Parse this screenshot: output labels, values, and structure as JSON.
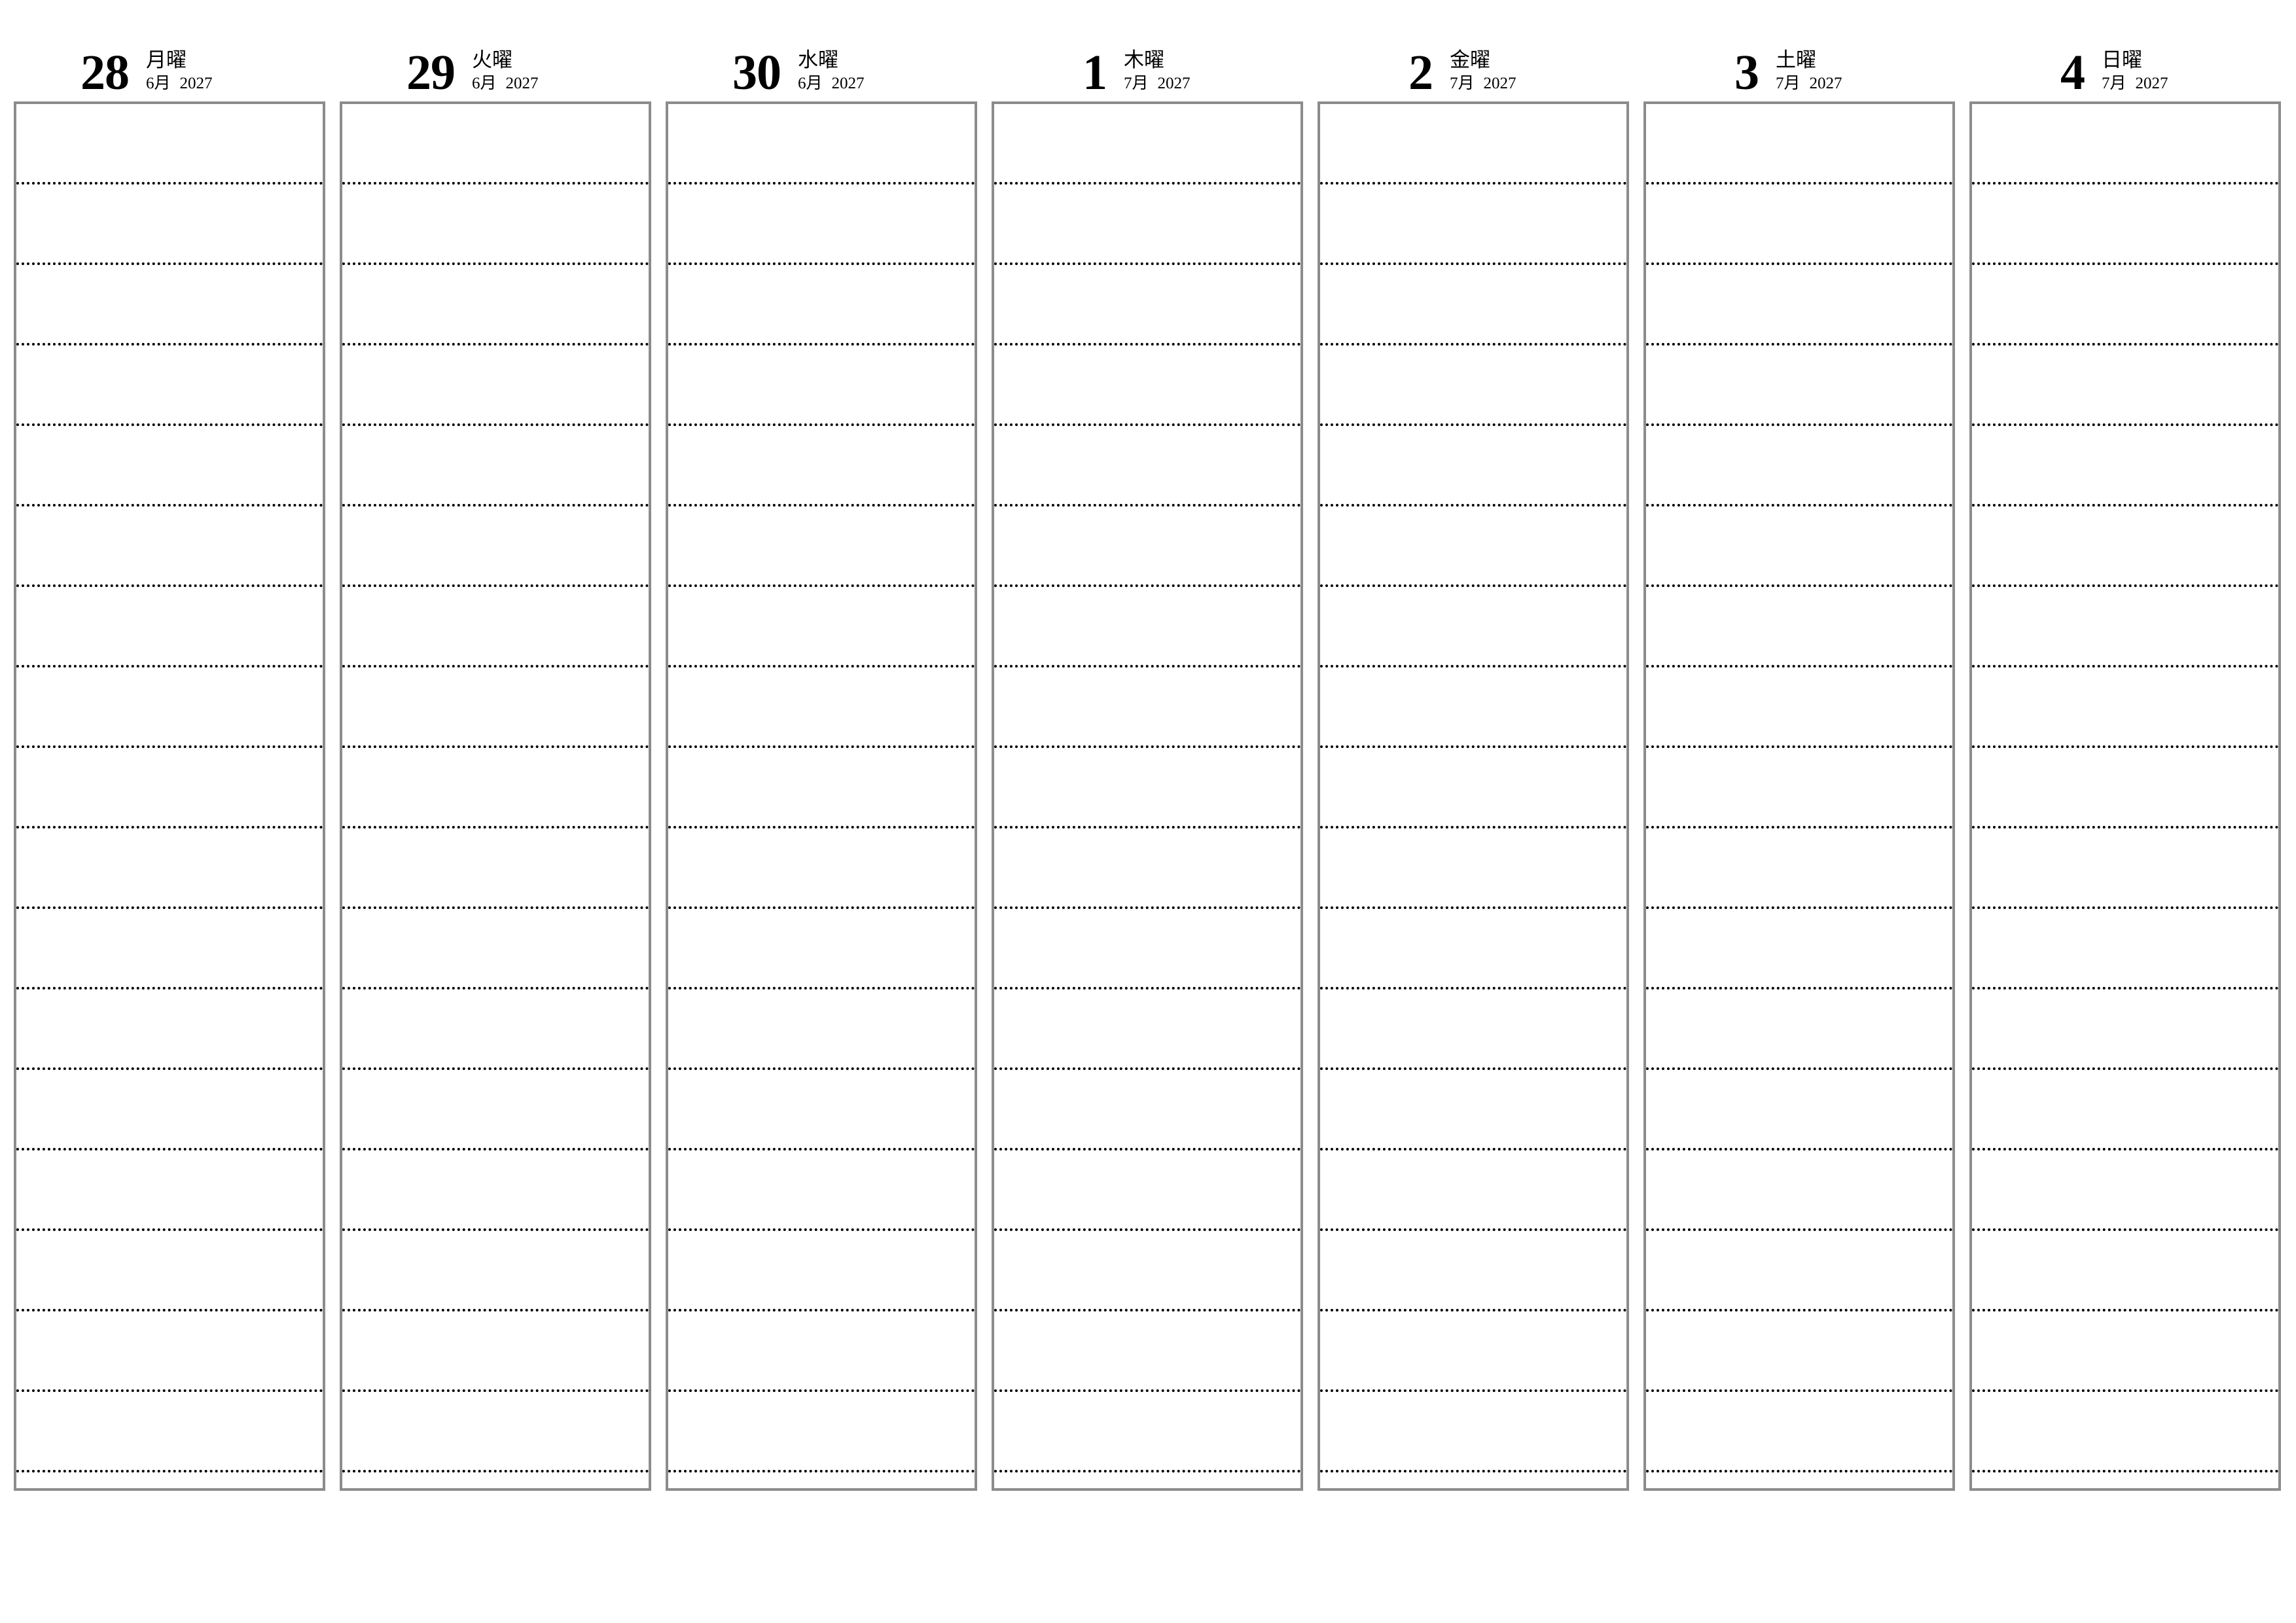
{
  "document": {
    "type": "weekly-planner",
    "orientation": "landscape",
    "language": "ja",
    "year": "2027",
    "lines_per_day": 17
  },
  "style": {
    "box_border_color": "#8c8c8c",
    "rule_line_color": "#000000",
    "text_color": "#000000",
    "background_color": "#ffffff"
  },
  "days": [
    {
      "day_number": "28",
      "weekday": "月曜",
      "month": "6月",
      "year": "2027"
    },
    {
      "day_number": "29",
      "weekday": "火曜",
      "month": "6月",
      "year": "2027"
    },
    {
      "day_number": "30",
      "weekday": "水曜",
      "month": "6月",
      "year": "2027"
    },
    {
      "day_number": "1",
      "weekday": "木曜",
      "month": "7月",
      "year": "2027"
    },
    {
      "day_number": "2",
      "weekday": "金曜",
      "month": "7月",
      "year": "2027"
    },
    {
      "day_number": "3",
      "weekday": "土曜",
      "month": "7月",
      "year": "2027"
    },
    {
      "day_number": "4",
      "weekday": "日曜",
      "month": "7月",
      "year": "2027"
    }
  ]
}
